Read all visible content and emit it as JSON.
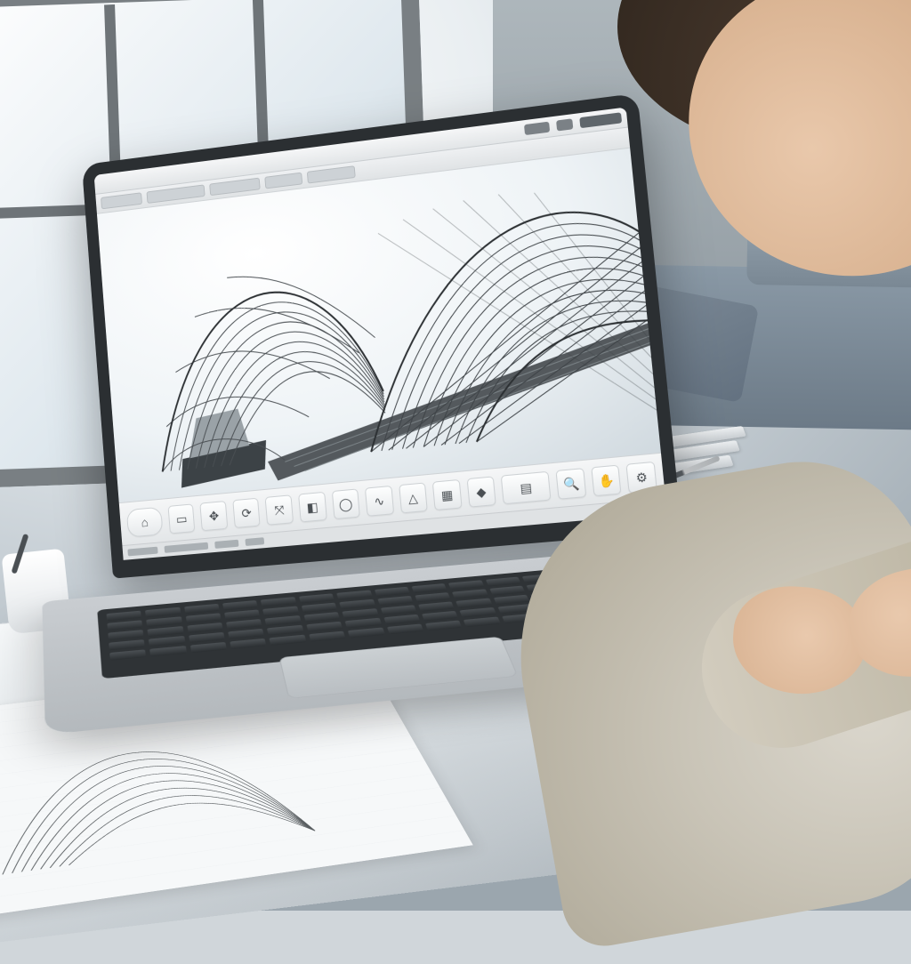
{
  "app": {
    "toolbar_icons": [
      "home-icon",
      "select-icon",
      "move-icon",
      "rotate-icon",
      "scale-icon",
      "box-icon",
      "sphere-icon",
      "curve-icon",
      "loft-icon",
      "mesh-icon",
      "material-icon",
      "render-icon",
      "zoom-icon",
      "pan-icon",
      "settings-icon"
    ]
  }
}
